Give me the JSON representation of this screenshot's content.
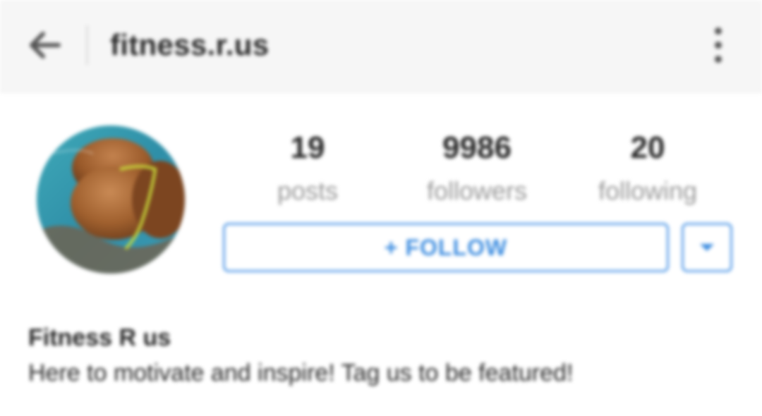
{
  "header": {
    "username": "fitness.r.us",
    "back_icon": "arrow-left-icon",
    "menu_icon": "more-vertical-icon"
  },
  "profile": {
    "avatar_icon": "profile-photo"
  },
  "stats": [
    {
      "value": "19",
      "label": "posts"
    },
    {
      "value": "9986",
      "label": "followers"
    },
    {
      "value": "20",
      "label": "following"
    }
  ],
  "actions": {
    "follow_label": "+ FOLLOW",
    "dropdown_icon": "caret-down-icon"
  },
  "bio": {
    "name": "Fitness R us",
    "text": "Here to motivate and inspire! Tag us to be featured!"
  },
  "colors": {
    "accent": "#3d8de0",
    "header_bg": "#f6f6f6",
    "muted_text": "#999999"
  }
}
